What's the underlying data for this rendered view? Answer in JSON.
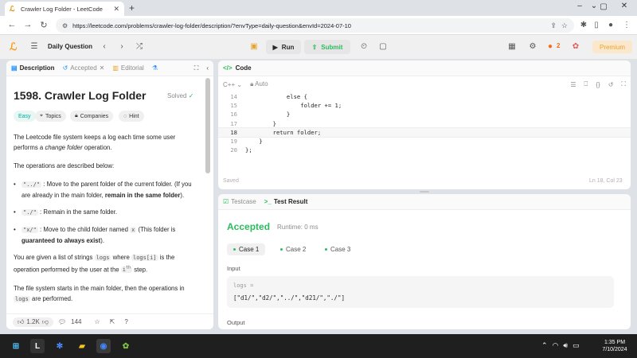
{
  "browser": {
    "tab_title": "Crawler Log Folder - LeetCode",
    "url": "https://leetcode.com/problems/crawler-log-folder/description/?envType=daily-question&envId=2024-07-10"
  },
  "header": {
    "daily_question": "Daily Question",
    "run_label": "Run",
    "submit_label": "Submit",
    "streak": "2",
    "premium_label": "Premium"
  },
  "left": {
    "tabs": [
      "Description",
      "Accepted",
      "Editorial"
    ],
    "title": "1598. Crawler Log Folder",
    "solved": "Solved",
    "chips": [
      "Easy",
      "Topics",
      "Companies",
      "Hint"
    ],
    "desc": {
      "p1a": "The Leetcode file system keeps a log each time some user performs a ",
      "p1em": "change folder",
      "p1b": " operation.",
      "p2": "The operations are described below:",
      "op1_code": "\"../\"",
      "op1a": " : Move to the parent folder of the current folder. (If you are already in the main folder, ",
      "op1b": "remain in the same folder",
      "op1c": ").",
      "op2_code": "\"./\"",
      "op2": " : Remain in the same folder.",
      "op3_code": "\"x/\"",
      "op3a": " : Move to the child folder named ",
      "op3_x": "x",
      "op3b": " (This folder is ",
      "op3c": "guaranteed to always exist",
      "op3d": ").",
      "p3a": "You are given a list of strings ",
      "p3_logs": "logs",
      "p3b": " where ",
      "p3_logsi": "logs[i]",
      "p3c": " is the operation performed by the user at the ",
      "p3_i": "i",
      "p3_th": "th",
      "p3d": " step.",
      "p4a": "The file system starts in the main folder, then the operations in ",
      "p4_logs": "logs",
      "p4b": " are performed."
    },
    "likes": "1.2K",
    "comments": "144"
  },
  "code": {
    "tab_label": "Code",
    "language": "C++",
    "auto": "Auto",
    "lines": [
      {
        "n": "14",
        "t": "            else {"
      },
      {
        "n": "15",
        "t": "                folder += 1;"
      },
      {
        "n": "16",
        "t": "            }"
      },
      {
        "n": "17",
        "t": "        }"
      },
      {
        "n": "18",
        "t": "        return folder;"
      },
      {
        "n": "19",
        "t": "    }"
      },
      {
        "n": "20",
        "t": "};"
      }
    ],
    "saved": "Saved",
    "cursor": "Ln 18, Col 23"
  },
  "result": {
    "tabs": [
      "Testcase",
      "Test Result"
    ],
    "status": "Accepted",
    "runtime": "Runtime: 0 ms",
    "cases": [
      "Case 1",
      "Case 2",
      "Case 3"
    ],
    "input_label": "Input",
    "logs_name": "logs =",
    "logs_value": "[\"d1/\",\"d2/\",\"../\",\"d21/\",\"./\"]",
    "output_label": "Output"
  },
  "taskbar": {
    "time": "1:35 PM",
    "date": "7/10/2024"
  },
  "colors": {
    "accent_green": "#2cbb5d",
    "brand_orange": "#f89f1b",
    "premium_gold": "#e5a530"
  }
}
